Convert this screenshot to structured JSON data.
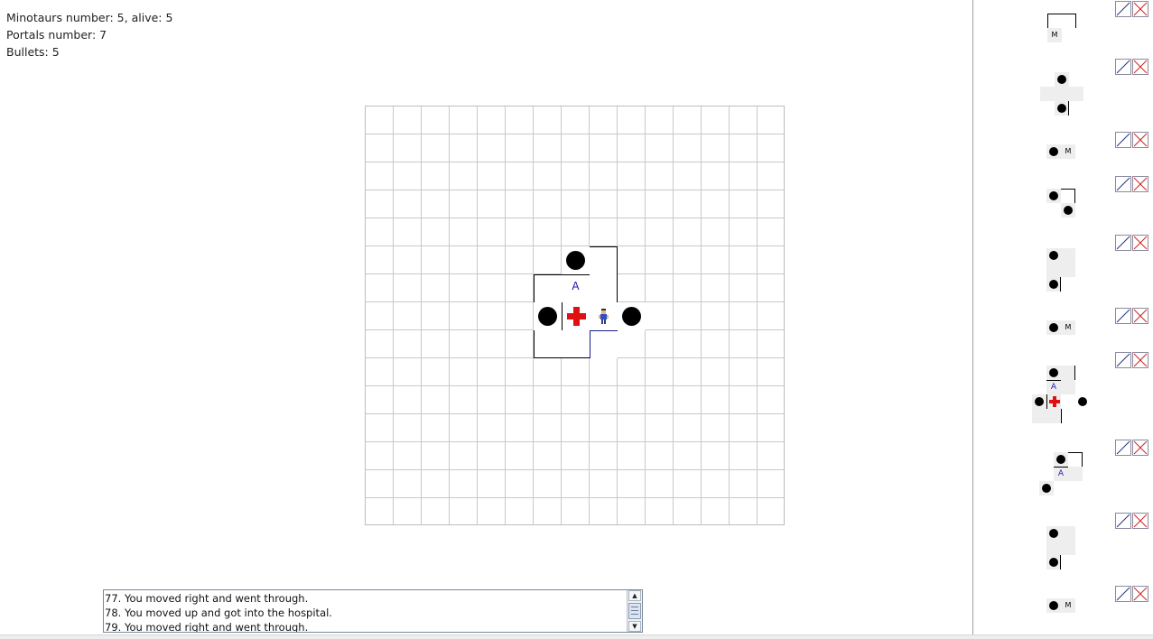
{
  "stats": {
    "minotaurs": "Minotaurs number: 5, alive: 5",
    "portals": "Portals number: 7",
    "bullets": "Bullets: 5"
  },
  "board": {
    "grid_size": 15,
    "arsenal_letter": "A",
    "marks": {
      "pit": "pit",
      "arsenal": "arsenal",
      "hospital": "hospital",
      "player": "player"
    }
  },
  "log": {
    "lines": [
      "77. You moved right and went through.",
      "78. You moved up and got into the hospital.",
      "79. You moved right and went through."
    ],
    "scroll_up_icon": "scroll-up-arrow-icon",
    "scroll_down_icon": "scroll-down-arrow-icon"
  },
  "history": {
    "minotaur_letter": "M",
    "arsenal_letter": "A",
    "control_icons": [
      "slash-icon",
      "cross-icon"
    ],
    "entries": 11
  },
  "colors": {
    "hospital_red": "#e01010",
    "arsenal_blue": "#1a1aa8",
    "cross_red": "#d02020",
    "slash_blue": "#203080"
  }
}
